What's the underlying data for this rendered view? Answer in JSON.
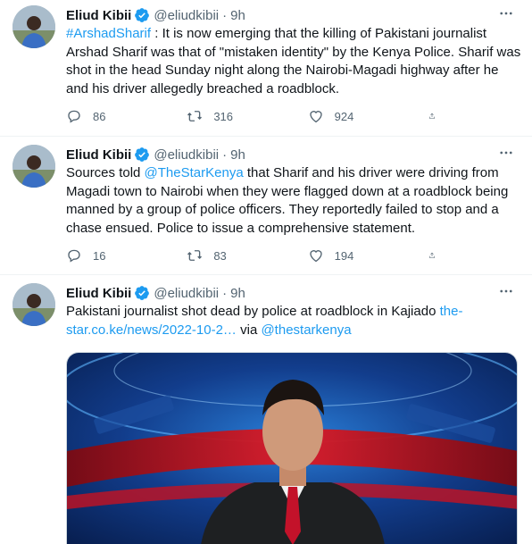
{
  "tweets": [
    {
      "name": "Eliud Kibii",
      "handle": "@eliudkibii",
      "dot": "·",
      "time": "9h",
      "hashtag": "#ArshadSharif",
      "text": " : It is now emerging that the killing of Pakistani journalist Arshad Sharif was that of \"mistaken identity\" by the Kenya Police. Sharif was shot in the head Sunday night along the Nairobi-Magadi highway after he and his driver allegedly breached a roadblock.",
      "replies": "86",
      "retweets": "316",
      "likes": "924"
    },
    {
      "name": "Eliud Kibii",
      "handle": "@eliudkibii",
      "dot": "·",
      "time": "9h",
      "text_before": "Sources told ",
      "mention": "@TheStarKenya",
      "text_after": "  that Sharif and his driver were driving from Magadi town to Nairobi when they were flagged down at a roadblock being manned by a group of police officers. They reportedly failed to stop and a chase ensued. Police to issue a comprehensive statement.",
      "replies": "16",
      "retweets": "83",
      "likes": "194"
    },
    {
      "name": "Eliud Kibii",
      "handle": "@eliudkibii",
      "dot": "·",
      "time": "9h",
      "text_before": "Pakistani journalist shot dead by police at roadblock in Kajiado ",
      "link": "the-star.co.ke/news/2022-10-2…",
      "text_mid": " via ",
      "mention": "@thestarkenya"
    }
  ],
  "icons": {
    "reply": "reply-icon",
    "retweet": "retweet-icon",
    "like": "heart-icon",
    "share": "share-icon",
    "more": "more-icon",
    "verified": "verified-badge-icon"
  },
  "colors": {
    "accent": "#1d9bf0",
    "secondary_text": "#536471",
    "text": "#0f1419"
  }
}
